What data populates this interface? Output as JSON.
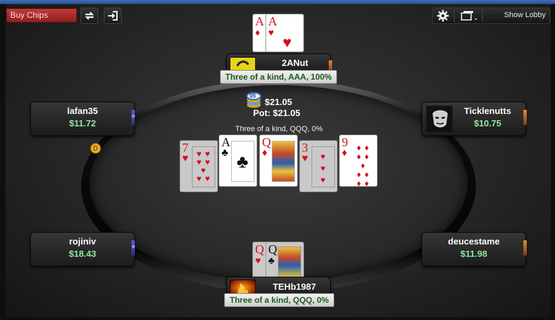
{
  "toolbar": {
    "buy_chips_label": "Buy Chips",
    "show_lobby_label": "Show Lobby",
    "icons": [
      "refresh-icon",
      "leave-table-icon",
      "gear-icon",
      "window-layout-icon"
    ]
  },
  "pot": {
    "chip_value_label": "05",
    "current_bet": "$21.05",
    "total": "Pot: $21.05"
  },
  "board": {
    "hand_label": "Three of a kind, QQQ, 0%",
    "cards": [
      {
        "rank": "7",
        "suit": "♥",
        "color": "red",
        "dimmed": true
      },
      {
        "rank": "A",
        "suit": "♣",
        "color": "black",
        "dimmed": false
      },
      {
        "rank": "Q",
        "suit": "♦",
        "color": "red",
        "dimmed": false
      },
      {
        "rank": "3",
        "suit": "♥",
        "color": "red",
        "dimmed": true
      },
      {
        "rank": "9",
        "suit": "♦",
        "color": "red",
        "dimmed": false
      }
    ]
  },
  "players": {
    "top": {
      "name": "2ANut",
      "hand_label": "Three of a kind, AAA, 100%",
      "cards": [
        {
          "rank": "A",
          "suit": "♦"
        },
        {
          "rank": "A",
          "suit": "♥"
        }
      ]
    },
    "top_left": {
      "name": "lafan35",
      "stack": "$11.72"
    },
    "top_right": {
      "name": "Ticklenutts",
      "stack": "$10.75"
    },
    "bottom_left": {
      "name": "rojiniv",
      "stack": "$18.43"
    },
    "bottom_right": {
      "name": "deucestame",
      "stack": "$11.98"
    },
    "hero": {
      "name": "TEHb1987",
      "hand_label": "Three of a kind, QQQ, 0%",
      "cards": [
        {
          "rank": "Q",
          "suit": "♥"
        },
        {
          "rank": "Q",
          "suit": "♣"
        }
      ]
    }
  },
  "dealer_button_label": "D",
  "colors": {
    "stack_green": "#8fe89a",
    "hand_label_green": "#1c5a1c",
    "buy_chips_red": "#c23a3a"
  }
}
